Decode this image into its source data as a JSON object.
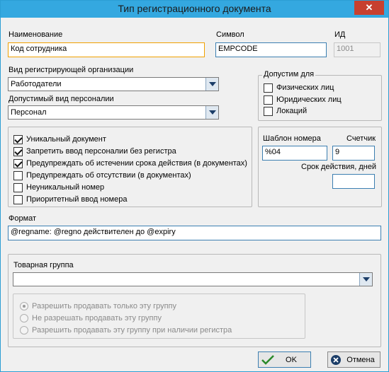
{
  "window": {
    "title": "Тип регистрационного документа",
    "close_glyph": "✕"
  },
  "fields": {
    "name_label": "Наименование",
    "name_value": "Код сотрудника",
    "symbol_label": "Символ",
    "symbol_value": "EMPCODE",
    "id_label": "ИД",
    "id_value": "1001",
    "org_type_label": "Вид регистрирующей организации",
    "org_type_value": "Работодатели",
    "personality_label": "Допустимый вид персоналии",
    "personality_value": "Персонал"
  },
  "allowed_for": {
    "caption": "Допустим для",
    "items": [
      {
        "label": "Физических лиц",
        "checked": false
      },
      {
        "label": "Юридических лиц",
        "checked": false
      },
      {
        "label": "Локаций",
        "checked": false
      }
    ]
  },
  "options": [
    {
      "label": "Уникальный документ",
      "checked": true
    },
    {
      "label": "Запретить ввод персоналии без регистра",
      "checked": true
    },
    {
      "label": "Предупреждать об истечении срока действия (в документах)",
      "checked": true
    },
    {
      "label": "Предупреждать об отсутствии (в документах)",
      "checked": false
    },
    {
      "label": "Неуникальный номер",
      "checked": false
    },
    {
      "label": "Приоритетный ввод номера",
      "checked": false
    }
  ],
  "numbering": {
    "template_label": "Шаблон номера",
    "template_value": "%04",
    "counter_label": "Счетчик",
    "counter_value": "9",
    "validity_label": "Срок действия, дней",
    "validity_value": ""
  },
  "format": {
    "label": "Формат",
    "value": "@regname: @regno действителен до @expiry"
  },
  "product_group": {
    "label": "Товарная группа",
    "value": "",
    "radios": [
      {
        "label": "Разрешить продавать только эту группу",
        "selected": true
      },
      {
        "label": "Не разрешать продавать эту группу",
        "selected": false
      },
      {
        "label": "Разрешить продавать эту группу при наличии регистра",
        "selected": false
      }
    ]
  },
  "buttons": {
    "ok": "OK",
    "cancel": "Отмена"
  },
  "colors": {
    "titlebar": "#34a8e0",
    "close": "#c7402f",
    "ok_icon": "#2a8a2a",
    "cancel_icon": "#1b3d68"
  }
}
